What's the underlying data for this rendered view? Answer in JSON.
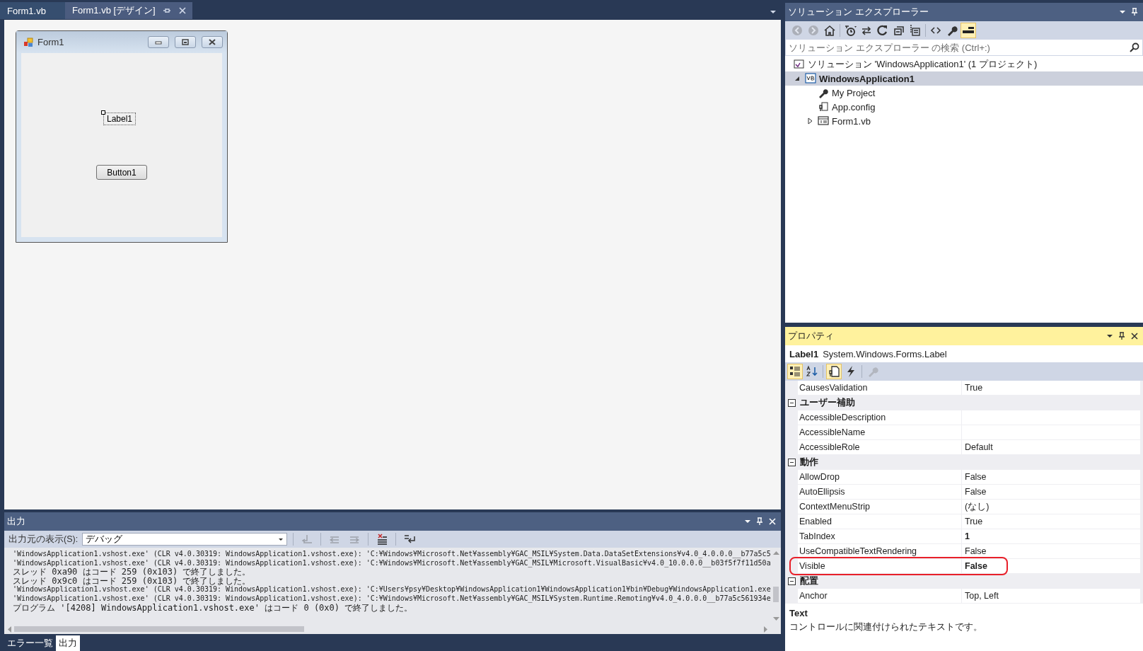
{
  "editor_tabs": [
    {
      "label": "Form1.vb",
      "selected": false
    },
    {
      "label": "Form1.vb [デザイン]",
      "selected": true
    }
  ],
  "form_window": {
    "title": "Form1",
    "controls": [
      {
        "kind": "label",
        "text": "Label1",
        "selected": true
      },
      {
        "kind": "button",
        "text": "Button1",
        "selected": false
      }
    ]
  },
  "output": {
    "title": "出力",
    "source_label": "出力元の表示(S):",
    "source_value": "デバッグ",
    "toolbar": [
      {
        "disabled": true
      },
      {
        "disabled": true
      },
      {
        "disabled": true
      },
      {
        "disabled": false
      },
      {
        "disabled": false
      }
    ],
    "lines": [
      {
        "kind": "log",
        "text": "'WindowsApplication1.vshost.exe' (CLR v4.0.30319: WindowsApplication1.vshost.exe): 'C:¥Windows¥Microsoft.Net¥assembly¥GAC_MSIL¥System.Data.DataSetExtensions¥v4.0_4.0.0.0__b77a5c5"
      },
      {
        "kind": "log",
        "text": "'WindowsApplication1.vshost.exe' (CLR v4.0.30319: WindowsApplication1.vshost.exe): 'C:¥Windows¥Microsoft.Net¥assembly¥GAC_MSIL¥Microsoft.VisualBasic¥v4.0_10.0.0.0__b03f5f7f11d50a"
      },
      {
        "kind": "status",
        "text": "スレッド 0xa90 はコード 259 (0x103) で終了しました。"
      },
      {
        "kind": "status",
        "text": "スレッド 0x9c0 はコード 259 (0x103) で終了しました。"
      },
      {
        "kind": "log",
        "text": "'WindowsApplication1.vshost.exe' (CLR v4.0.30319: WindowsApplication1.vshost.exe): 'C:¥Users¥psy¥Desktop¥WindowsApplication1¥WindowsApplication1¥bin¥Debug¥WindowsApplication1.exe"
      },
      {
        "kind": "log",
        "text": "'WindowsApplication1.vshost.exe' (CLR v4.0.30319: WindowsApplication1.vshost.exe): 'C:¥Windows¥Microsoft.Net¥assembly¥GAC_MSIL¥System.Runtime.Remoting¥v4.0_4.0.0.0__b77a5c561934e"
      },
      {
        "kind": "status",
        "text": "プログラム '[4208] WindowsApplication1.vshost.exe' はコード 0 (0x0) で終了しました。"
      }
    ]
  },
  "bottom_tabs": [
    {
      "label": "エラー一覧",
      "selected": false
    },
    {
      "label": "出力",
      "selected": true
    }
  ],
  "solution_explorer": {
    "title": "ソリューション エクスプローラー",
    "toolbar": [
      {
        "disabled": true,
        "selected": false
      },
      {
        "disabled": true,
        "selected": false
      },
      {
        "disabled": false,
        "selected": false
      },
      {
        "disabled": false,
        "selected": false
      },
      {
        "disabled": false,
        "selected": false
      },
      {
        "disabled": false,
        "selected": false
      },
      {
        "disabled": false,
        "selected": false
      },
      {
        "disabled": false,
        "selected": false
      },
      {
        "disabled": false,
        "selected": false
      },
      {
        "disabled": false,
        "selected": false
      },
      {
        "disabled": false,
        "selected": true
      }
    ],
    "search": {
      "placeholder": "ソリューション エクスプローラー の検索 (Ctrl+:)"
    },
    "tree": [
      {
        "kind": "solution",
        "label": "ソリューション 'WindowsApplication1' (1 プロジェクト)",
        "selected": false,
        "startup": false,
        "children": [
          {
            "kind": "project",
            "label": "WindowsApplication1",
            "selected": true,
            "startup": true,
            "expanded": true,
            "children": [
              {
                "kind": "myproject",
                "label": "My Project",
                "selected": false,
                "startup": false
              },
              {
                "kind": "config",
                "label": "App.config",
                "selected": false,
                "startup": false
              },
              {
                "kind": "form",
                "label": "Form1.vb",
                "selected": false,
                "startup": false,
                "expanded": false
              }
            ]
          }
        ]
      }
    ]
  },
  "properties": {
    "title": "プロパティ",
    "object_name": "Label1",
    "object_type": "System.Windows.Forms.Label",
    "toolbar": [
      {
        "selected": true,
        "disabled": false
      },
      {
        "selected": false,
        "disabled": false
      },
      {
        "selected": true,
        "disabled": false
      },
      {
        "selected": false,
        "disabled": false
      },
      {
        "selected": false,
        "disabled": true
      }
    ],
    "rows": [
      {
        "kind": "property",
        "name": "CausesValidation",
        "value": "True",
        "modified": false,
        "highlighted": false
      },
      {
        "kind": "category",
        "name": "ユーザー補助",
        "expanded": true
      },
      {
        "kind": "property",
        "name": "AccessibleDescription",
        "highlighted": false
      },
      {
        "kind": "property",
        "name": "AccessibleName",
        "highlighted": false
      },
      {
        "kind": "property",
        "name": "AccessibleRole",
        "value": "Default",
        "modified": false,
        "highlighted": false
      },
      {
        "kind": "category",
        "name": "動作",
        "expanded": true
      },
      {
        "kind": "property",
        "name": "AllowDrop",
        "value": "False",
        "modified": false,
        "highlighted": false
      },
      {
        "kind": "property",
        "name": "AutoEllipsis",
        "value": "False",
        "modified": false,
        "highlighted": false
      },
      {
        "kind": "property",
        "name": "ContextMenuStrip",
        "value": "(なし)",
        "modified": false,
        "highlighted": false
      },
      {
        "kind": "property",
        "name": "Enabled",
        "value": "True",
        "modified": false,
        "highlighted": false
      },
      {
        "kind": "property",
        "name": "TabIndex",
        "value": "1",
        "modified": true,
        "highlighted": false
      },
      {
        "kind": "property",
        "name": "UseCompatibleTextRendering",
        "value": "False",
        "modified": false,
        "highlighted": false
      },
      {
        "kind": "property",
        "name": "Visible",
        "value": "False",
        "modified": true,
        "highlighted": true
      },
      {
        "kind": "category",
        "name": "配置",
        "expanded": true
      },
      {
        "kind": "property",
        "name": "Anchor",
        "value": "Top, Left",
        "modified": false,
        "highlighted": false
      }
    ],
    "description": {
      "title": "Text",
      "text": "コントロールに関連付けられたテキストです。"
    }
  }
}
